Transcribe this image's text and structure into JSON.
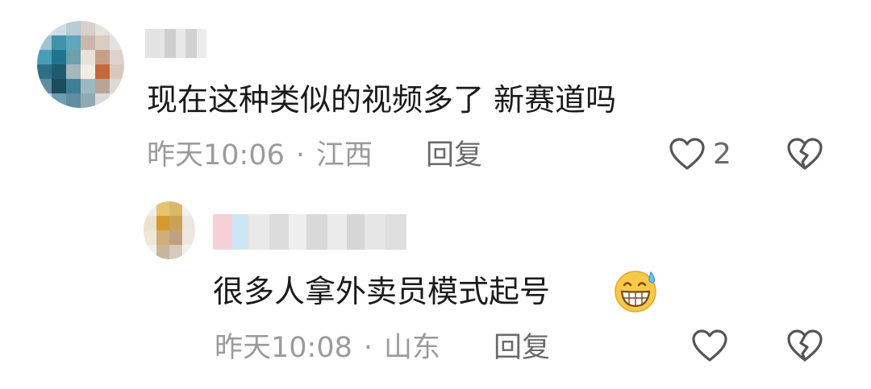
{
  "comment": {
    "text": "现在这种类似的视频多了 新赛道吗",
    "time": "昨天10:06",
    "separator": "·",
    "location": "江西",
    "reply_label": "回复",
    "like_count": "2",
    "like_icon": "heart-outline-icon",
    "dislike_icon": "broken-heart-icon"
  },
  "reply": {
    "text": "很多人拿外卖员模式起号",
    "emoji": "grinning-sweat-emoji",
    "time": "昨天10:08",
    "separator": "·",
    "location": "山东",
    "reply_label": "回复",
    "like_icon": "heart-outline-icon",
    "dislike_icon": "broken-heart-icon"
  },
  "colors": {
    "text": "#1a1a1a",
    "meta": "#9b9b9b",
    "reply_link": "#6a6a6a",
    "icon": "#555555"
  }
}
